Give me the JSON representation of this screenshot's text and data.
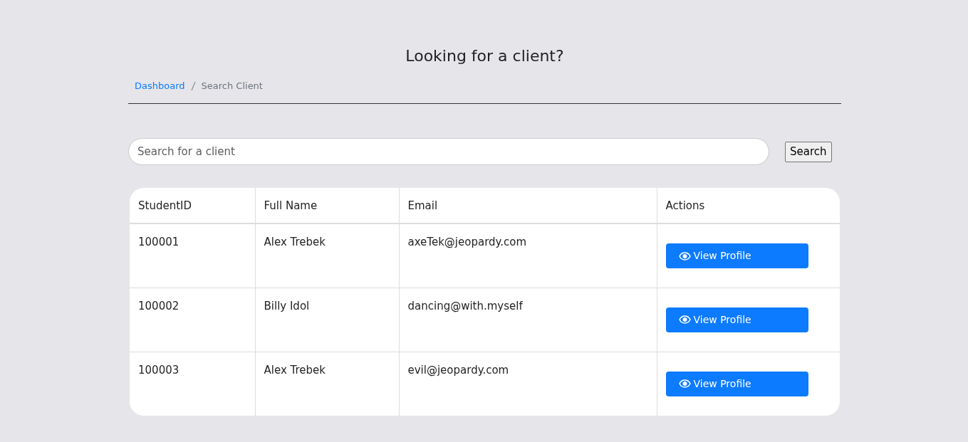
{
  "heading": "Looking for a client?",
  "breadcrumb": [
    {
      "label": "Dashboard",
      "current": false
    },
    {
      "label": "Search Client",
      "current": true
    }
  ],
  "search": {
    "placeholder": "Search for a client",
    "button": "Search"
  },
  "table": {
    "columns": [
      "StudentID",
      "Full Name",
      "Email",
      "Actions"
    ],
    "rows": [
      {
        "id": "100001",
        "name": "Alex Trebek",
        "email": "axeTek@jeopardy.com",
        "action": "View Profile"
      },
      {
        "id": "100002",
        "name": "Billy Idol",
        "email": "dancing@with.myself",
        "action": "View Profile"
      },
      {
        "id": "100003",
        "name": "Alex Trebek",
        "email": "evil@jeopardy.com",
        "action": "View Profile"
      }
    ]
  }
}
